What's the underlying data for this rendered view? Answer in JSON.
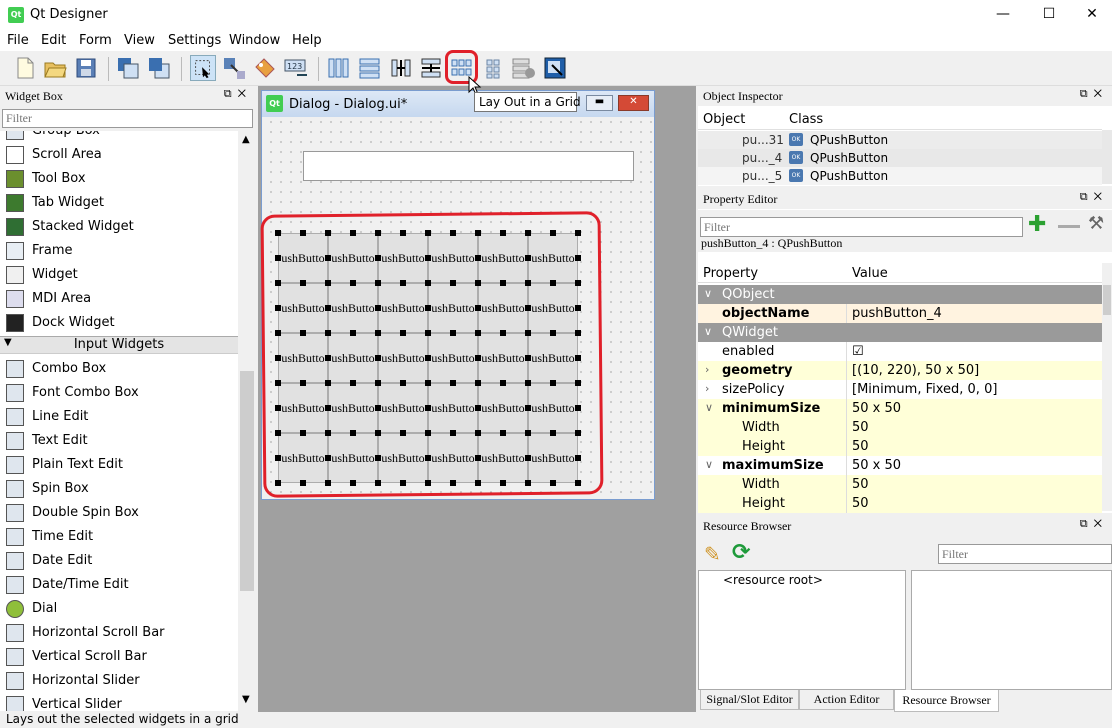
{
  "window": {
    "title": "Qt Designer",
    "minimize": "—",
    "maximize": "☐",
    "close": "✕",
    "app_icon": "qt-logo"
  },
  "menu": [
    "File",
    "Edit",
    "Form",
    "View",
    "Settings",
    "Window",
    "Help"
  ],
  "tooltip": "Lay Out in a Grid",
  "status": "Lays out the selected widgets in a grid",
  "widget_box": {
    "title": "Widget Box",
    "filter_placeholder": "Filter",
    "items_top": [
      "Group Box",
      "Scroll Area",
      "Tool Box",
      "Tab Widget",
      "Stacked Widget",
      "Frame",
      "Widget",
      "MDI Area",
      "Dock Widget"
    ],
    "category": "Input Widgets",
    "items_input": [
      "Combo Box",
      "Font Combo Box",
      "Line Edit",
      "Text Edit",
      "Plain Text Edit",
      "Spin Box",
      "Double Spin Box",
      "Time Edit",
      "Date Edit",
      "Date/Time Edit",
      "Dial",
      "Horizontal Scroll Bar",
      "Vertical Scroll Bar",
      "Horizontal Slider",
      "Vertical Slider"
    ]
  },
  "dialog": {
    "title": "Dialog - Dialog.ui*",
    "button_text": "ushButto"
  },
  "object_inspector": {
    "title": "Object Inspector",
    "col_object": "Object",
    "col_class": "Class",
    "rows": [
      {
        "object": "pu...31",
        "class": "QPushButton"
      },
      {
        "object": "pu..._4",
        "class": "QPushButton"
      },
      {
        "object": "pu..._5",
        "class": "QPushButton"
      }
    ]
  },
  "property_editor": {
    "title": "Property Editor",
    "filter_placeholder": "Filter",
    "context": "pushButton_4 : QPushButton",
    "col_property": "Property",
    "col_value": "Value",
    "rows": [
      {
        "kind": "group",
        "name": "QObject",
        "expander": "∨"
      },
      {
        "kind": "prop",
        "name": "objectName",
        "value": "pushButton_4",
        "bold": true,
        "bg": "#fff3e0"
      },
      {
        "kind": "group",
        "name": "QWidget",
        "expander": "∨"
      },
      {
        "kind": "prop",
        "name": "enabled",
        "value": "☑",
        "bold": false,
        "bg": "#fff"
      },
      {
        "kind": "prop",
        "name": "geometry",
        "value": "[(10, 220), 50 x 50]",
        "bold": true,
        "bg": "#ffffd8",
        "expander": "›"
      },
      {
        "kind": "prop",
        "name": "sizePolicy",
        "value": "[Minimum, Fixed, 0, 0]",
        "bold": false,
        "bg": "#fff",
        "expander": "›"
      },
      {
        "kind": "prop",
        "name": "minimumSize",
        "value": "50 x 50",
        "bold": true,
        "bg": "#ffffd8",
        "expander": "∨"
      },
      {
        "kind": "sub",
        "name": "Width",
        "value": "50",
        "bg": "#ffffd8"
      },
      {
        "kind": "sub",
        "name": "Height",
        "value": "50",
        "bg": "#ffffd8"
      },
      {
        "kind": "prop",
        "name": "maximumSize",
        "value": "50 x 50",
        "bold": true,
        "bg": "#fff",
        "expander": "∨"
      },
      {
        "kind": "sub",
        "name": "Width",
        "value": "50",
        "bg": "#ffffd8"
      },
      {
        "kind": "sub",
        "name": "Height",
        "value": "50",
        "bg": "#ffffd8"
      }
    ]
  },
  "resource_browser": {
    "title": "Resource Browser",
    "filter_placeholder": "Filter",
    "root": "<resource root>"
  },
  "bottom_tabs": [
    "Signal/Slot Editor",
    "Action Editor",
    "Resource Browser"
  ]
}
